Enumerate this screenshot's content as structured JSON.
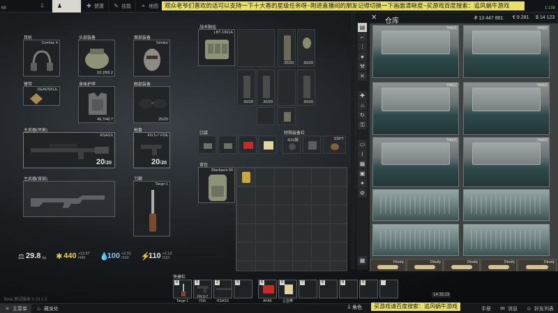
{
  "top": {
    "stats_line1": "",
    "stats_line2": "68",
    "tabs": [
      {
        "label": "",
        "icon": "download-icon"
      },
      {
        "label": "",
        "icon": "character-icon",
        "active": true
      },
      {
        "label": "健康",
        "icon": "health-icon"
      },
      {
        "label": "技能",
        "icon": "skills-icon"
      },
      {
        "label": "地图",
        "icon": "map-icon"
      },
      {
        "label": "任",
        "icon": "tasks-icon"
      }
    ],
    "marquee": "观众老爷们喜欢的话可以支持一下十大香的星级任务呀~刚进直播间的朋友记得切换一下画面清晰度~买游戏百度搜索：追风蜗牛游戏",
    "right_line1": "",
    "right_line2": "1:198"
  },
  "gear": {
    "earpiece": {
      "label": "耳机",
      "name": "Comtac 4"
    },
    "headwear": {
      "label": "头部装备",
      "name": "",
      "value": "52.2/55.2"
    },
    "face": {
      "label": "面部装备",
      "name": "Smoke"
    },
    "armband": {
      "label": "臂带",
      "name": "DEADSKUL"
    },
    "armor": {
      "label": "身体护甲",
      "name": "",
      "value": "40.7/40.7"
    },
    "eyewear": {
      "label": "眼部装备",
      "name": "",
      "value": "25/25"
    },
    "primary": {
      "label": "主武器(吊索)",
      "name": "RSASS",
      "ammo": "20",
      "cap": "20"
    },
    "holster": {
      "label": "枪套",
      "name": "FN 5-7 FDE",
      "ammo": "20",
      "cap": "20"
    },
    "primary_back": {
      "label": "主武器(背部)",
      "name": ""
    },
    "melee": {
      "label": "刀鞘",
      "name": "Targe-1"
    }
  },
  "status": {
    "weight": "29.8",
    "weight_unit": "kg",
    "energy": "440",
    "energy_sub": "+13.57",
    "energy_max": "/440",
    "hydration": "100",
    "hydration_sub": "+2.01",
    "hydration_max": "/100",
    "stamina": "110",
    "stamina_sub": "+2.12",
    "stamina_max": "/110"
  },
  "middle": {
    "rig_label": "战术胸挂",
    "rig_name": "LBT-1961A",
    "pocket_label": "口袋",
    "special_label": "特殊装备栏",
    "special_items": [
      "R15腕",
      "",
      "SSPT"
    ],
    "backpack_label": "背包",
    "backpack_name": "Blackjack 50",
    "rig_mags": [
      "20/20",
      "20/20",
      "20/20",
      "20/20",
      "20/20",
      "20/20",
      "20/20",
      "20/20"
    ]
  },
  "stash": {
    "title": "仓库",
    "rubles": "₽ 13 447 861",
    "euros": "€ 9 281",
    "dollars": "$ 14 123",
    "case_tag": "THICC",
    "box_tag": "",
    "drizzly_tag": "Drizzly",
    "side_icons": [
      "all-icon",
      "weapon-icon",
      "ammo-icon",
      "grenade-icon",
      "tools-icon",
      "medical-icon",
      "food-icon",
      "container-icon",
      "barter-icon",
      "key-icon",
      "map-icon",
      "settings-icon"
    ]
  },
  "hotbar": {
    "label": "快捷栏",
    "slots": [
      {
        "n": "4",
        "name": "Targe-1"
      },
      {
        "n": "1",
        "name": "FN 5-7 FDE"
      },
      {
        "n": "2",
        "name": "RSASS"
      },
      {
        "n": "3",
        "name": ""
      },
      {
        "n": "5",
        "name": "AFAK"
      },
      {
        "n": "6",
        "name": "止血带"
      },
      {
        "n": "7",
        "name": ""
      },
      {
        "n": "8",
        "name": ""
      },
      {
        "n": "9",
        "name": ""
      },
      {
        "n": "0",
        "name": ""
      },
      {
        "n": "",
        "name": ""
      }
    ]
  },
  "bottom": {
    "version": "Beta 测试版本 0.13.1.2",
    "main_menu": "主菜单",
    "hideout": "藏身处",
    "role": "角色",
    "trade": "交易",
    "ad": "买游戏请百度搜索：追风蜗牛游戏",
    "messages": "消息",
    "friends": "好友列表",
    "clock": "14:35:23",
    "hand": "手册"
  }
}
